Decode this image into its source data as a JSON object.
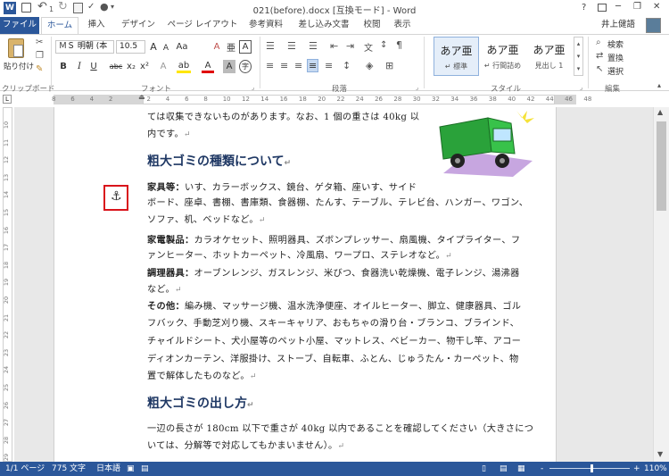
{
  "titlebar": {
    "title": "021(before).docx [互換モード] - Word",
    "help": "?",
    "minimize": "─",
    "restore": "❐",
    "close": "✕",
    "qat_count": "1"
  },
  "tabs": {
    "file": "ファイル",
    "home": "ホーム",
    "insert": "挿入",
    "design": "デザイン",
    "layout": "ページ レイアウト",
    "references": "参考資料",
    "mailings": "差し込み文書",
    "review": "校閲",
    "view": "表示",
    "user": "井上健語"
  },
  "ribbon": {
    "clipboard": {
      "paste": "貼り付け",
      "label": "クリップボード"
    },
    "font": {
      "name": "ＭＳ 明朝 (本",
      "size": "10.5",
      "grow": "A",
      "shrink": "A",
      "case": "Aa",
      "clear": "A",
      "ruby": "亜",
      "box": "A",
      "bold": "B",
      "italic": "I",
      "underline": "U",
      "strike": "abc",
      "sub": "x₂",
      "sup": "x²",
      "effects": "A",
      "highlight": "ab",
      "color": "A",
      "shade": "A",
      "circle": "字",
      "label": "フォント"
    },
    "paragraph": {
      "label": "段落"
    },
    "styles": {
      "items": [
        {
          "preview": "あア亜",
          "name": "↵ 標準"
        },
        {
          "preview": "あア亜",
          "name": "↵ 行間詰め"
        },
        {
          "preview": "あア亜",
          "name": "見出し 1"
        }
      ],
      "label": "スタイル"
    },
    "editing": {
      "find": "検索",
      "replace": "置換",
      "select": "選択",
      "label": "編集"
    }
  },
  "ruler": {
    "h_ticks": [
      "8",
      "6",
      "4",
      "2",
      "",
      "2",
      "4",
      "6",
      "8",
      "10",
      "12",
      "14",
      "16",
      "18",
      "20",
      "22",
      "24",
      "26",
      "28",
      "30",
      "32",
      "34",
      "36",
      "38",
      "40",
      "42",
      "44",
      "46",
      "48"
    ],
    "v_ticks": [
      "10",
      "11",
      "12",
      "13",
      "14",
      "15",
      "16",
      "17",
      "18",
      "19",
      "20",
      "21",
      "22",
      "23",
      "24",
      "25",
      "26",
      "27",
      "28",
      "29"
    ]
  },
  "document": {
    "line1": "ては収集できないものがあります。なお、1 個の重さは 40kg 以",
    "line2": "内です。",
    "heading1": "粗大ゴミの種類について",
    "furniture_label": "家具等：",
    "furniture_text1": "いす、カラーボックス、鏡台、ゲタ箱、座いす、サイド",
    "furniture_text2": "ボード、座卓、書棚、書庫類、食器棚、たんす、テーブル、テレビ台、ハンガー、ワゴン、",
    "furniture_text3": "ソファ、机、ベッドなど。",
    "appliance_label": "家電製品：",
    "appliance_text1": "カラオケセット、照明器具、ズボンプレッサー、扇風機、タイプライター、フ",
    "appliance_text2": "ァンヒーター、ホットカーペット、冷風扇、ワープロ、ステレオなど。",
    "cooking_label": "調理器具：",
    "cooking_text1": "オーブンレンジ、ガスレンジ、米びつ、食器洗い乾燥機、電子レンジ、湯沸器",
    "cooking_text2": "など。",
    "other_label": "その他：",
    "other_text1": "編み機、マッサージ機、温水洗浄便座、オイルヒーター、脚立、健康器具、ゴル",
    "other_text2": "フバック、手動芝刈り機、スキーキャリア、おもちゃの滑り台・ブランコ、ブラインド、",
    "other_text3": "チャイルドシート、犬小屋等のペット小屋、マットレス、ベビーカー、物干し竿、アコー",
    "other_text4": "ディオンカーテン、洋服掛け、ストーブ、自転車、ふとん、じゅうたん・カーペット、物",
    "other_text5": "置で解体したものなど。",
    "heading2": "粗大ゴミの出し方",
    "howto_text1": "一辺の長さが 180cm 以下で重さが 40kg 以内であることを確認してください（大きさにつ",
    "howto_text2": "いては、分解等で対応してもかまいません）。",
    "para_mark": "↵"
  },
  "statusbar": {
    "page": "1/1 ページ",
    "words": "775 文字",
    "lang": "日本語",
    "zoom": "110%",
    "zoom_minus": "-",
    "zoom_plus": "+"
  },
  "colors": {
    "accent": "#2b579a",
    "heading": "#1f3864",
    "highlight_box": "#d9141b"
  }
}
